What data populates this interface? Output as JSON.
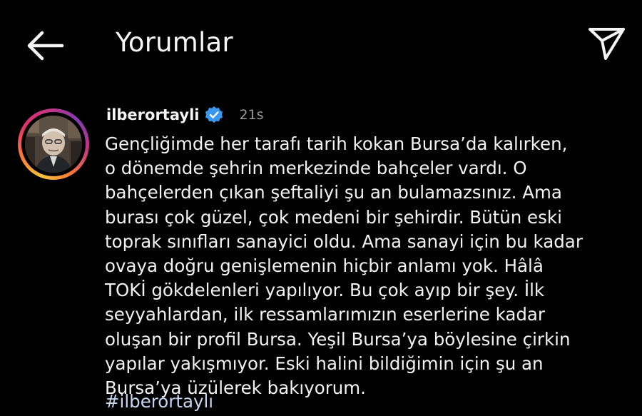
{
  "header": {
    "title": "Yorumlar",
    "back_icon": "arrow-left-icon",
    "send_icon": "paper-plane-icon"
  },
  "comment": {
    "username": "ilberortayli",
    "verified_icon": "verified-badge-icon",
    "verified_color": "#3897f0",
    "time": "21s",
    "text": "Gençliğimde her tarafı tarih kokan Bursa’da kalırken,\no dönemde şehrin merkezinde bahçeler vardı. O\nbahçelerden çıkan şeftaliyi şu an bulamazsınız. Ama\nburası çok güzel, çok medeni bir şehirdir. Bütün eski\ntoprak sınıfları sanayici oldu. Ama sanayi için bu kadar\novaya doğru genişlemenin hiçbir anlamı yok. Hâlâ\nTOKİ gökdelenleri yapılıyor. Bu çok ayıp bir şey. İlk\nseyyahlardan, ilk ressamlarımızın eserlerine kadar\noluşan bir profil Bursa. Yeşil Bursa’ya böylesine çirkin\nyapılar yakışmıyor. Eski halini bildiğimin için şu an\nBursa’ya üzülerek bakıyorum.",
    "hashtag": "#ilberortaylı"
  },
  "colors": {
    "background": "#000000",
    "text": "#f5f5f5",
    "muted": "#9a9a9a",
    "hashtag": "#c7d5ef"
  }
}
